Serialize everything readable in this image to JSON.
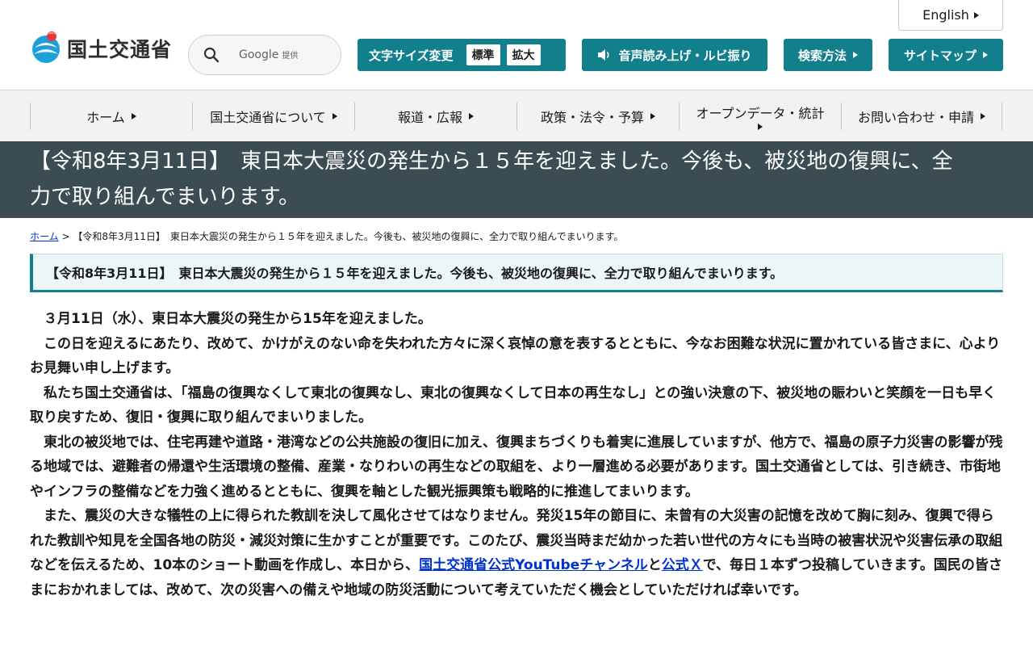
{
  "header": {
    "site_name": "国土交通省",
    "language_link": "English",
    "search": {
      "placeholder": "",
      "provider": "Google",
      "provider_suffix": "提供"
    },
    "font_size": {
      "label": "文字サイズ変更",
      "standard": "標準",
      "large": "拡大"
    },
    "voice_button": "音声読み上げ・ルビ振り",
    "search_method_button": "検索方法",
    "sitemap_button": "サイトマップ",
    "brand_color": "#117f8c"
  },
  "nav": {
    "items": [
      {
        "label": "ホーム"
      },
      {
        "label": "国土交通省について"
      },
      {
        "label": "報道・広報"
      },
      {
        "label": "政策・法令・予算"
      },
      {
        "label": "オープンデータ・統計"
      },
      {
        "label": "お問い合わせ・申請"
      }
    ]
  },
  "page": {
    "title": "【令和8年3月11日】　東日本大震災の発生から１５年を迎えました。今後も、被災地の復興に、全力で取り組んでまいります。",
    "breadcrumb": {
      "home": "ホーム",
      "separator": ">",
      "current": "【令和8年3月11日】　東日本大震災の発生から１５年を迎えました。今後も、被災地の復興に、全力で取り組んでまいります。"
    },
    "heading": "【令和8年3月11日】　東日本大震災の発生から１５年を迎えました。今後も、被災地の復興に、全力で取り組んでまいります。"
  },
  "article": {
    "p1": "３月11日（水）、東日本大震災の発生から15年を迎えました。",
    "p2": "この日を迎えるにあたり、改めて、かけがえのない命を失われた方々に深く哀悼の意を表するとともに、今なお困難な状況に置かれている皆さまに、心よりお見舞い申し上げます。",
    "p3": "私たち国土交通省は、「福島の復興なくして東北の復興なし、東北の復興なくして日本の再生なし」との強い決意の下、被災地の賑わいと笑顔を一日も早く取り戻すため、復旧・復興に取り組んでまいりました。",
    "p4": "東北の被災地では、住宅再建や道路・港湾などの公共施設の復旧に加え、復興まちづくりも着実に進展していますが、他方で、福島の原子力災害の影響が残る地域では、避難者の帰還や生活環境の整備、産業・なりわいの再生などの取組を、より一層進める必要があります。国土交通省としては、引き続き、市街地やインフラの整備などを力強く進めるとともに、復興を軸とした観光振興策も戦略的に推進してまいります。",
    "p5_before": "また、震災の大きな犠牲の上に得られた教訓を決して風化させてはなりません。発災15年の節目に、未曾有の大災害の記憶を改めて胸に刻み、復興で得られた教訓や知見を全国各地の防災・減災対策に生かすことが重要です。このたび、震災当時まだ幼かった若い世代の方々にも当時の被害状況や災害伝承の取組などを伝えるため、10本のショート動画を作成し、本日から、",
    "p5_link1": "国土交通省公式YouTubeチャンネル",
    "p5_mid": "と",
    "p5_link2": "公式Ｘ",
    "p5_after": "で、毎日１本ずつ投稿していきます。国民の皆さまにおかれましては、改めて、次の災害への備えや地域の防災活動について考えていただく機会としていただければ幸いです。"
  }
}
